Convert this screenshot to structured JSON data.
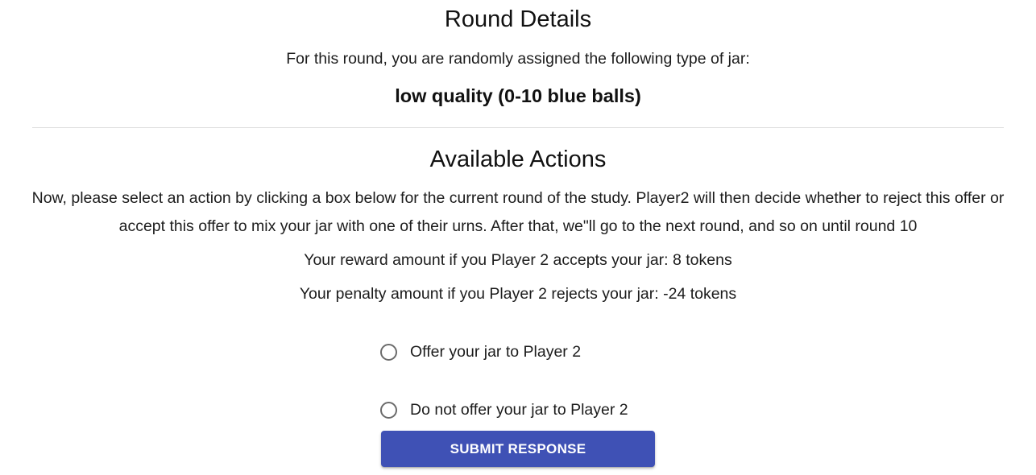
{
  "round_details": {
    "title": "Round Details",
    "assignment_text": "For this round, you are randomly assigned the following type of jar:",
    "jar_type": "low quality (0-10 blue balls)"
  },
  "available_actions": {
    "title": "Available Actions",
    "instructions": "Now, please select an action by clicking a box below for the current round of the study. Player2 will then decide whether to reject this offer or accept this offer to mix your jar with one of their urns. After that, we\"ll go to the next round, and so on until round 10",
    "reward_text": "Your reward amount if you Player 2 accepts your jar: 8 tokens",
    "penalty_text": "Your penalty amount if you Player 2 rejects your jar: -24 tokens",
    "options": [
      {
        "label": "Offer your jar to Player 2",
        "selected": false
      },
      {
        "label": "Do not offer your jar to Player 2",
        "selected": false
      }
    ],
    "submit_label": "Submit Response"
  },
  "colors": {
    "primary_button": "#3f51b5",
    "radio_border": "#6b6b6b",
    "divider": "#e0e0e0"
  }
}
